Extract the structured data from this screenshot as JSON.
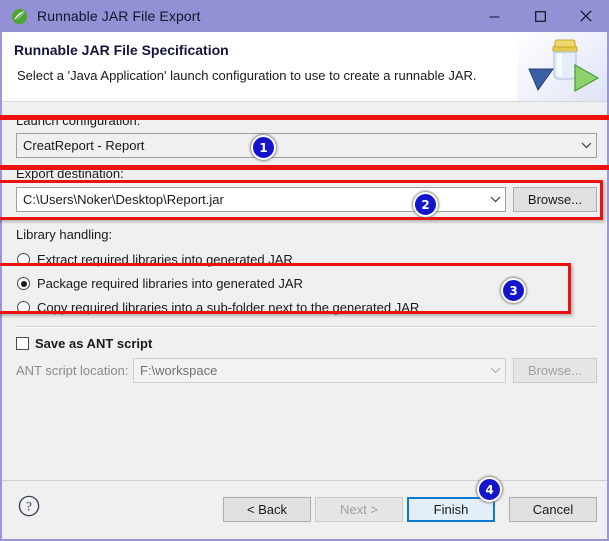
{
  "window": {
    "title": "Runnable JAR File Export",
    "icon": "eclipse-leaf-icon",
    "controls": {
      "minimize": "minimize-icon",
      "maximize": "maximize-icon",
      "close": "close-icon"
    },
    "titlebar_color": "#9490d6"
  },
  "header": {
    "title": "Runnable JAR File Specification",
    "description": "Select a 'Java Application' launch configuration to use to create a runnable JAR.",
    "icon": "jar-export-icon"
  },
  "launch_configuration": {
    "label": "Launch configuration:",
    "value": "CreatReport - Report",
    "chevron": "chevron-down-icon"
  },
  "export_destination": {
    "label": "Export destination:",
    "value": "C:\\Users\\Noker\\Desktop\\Report.jar",
    "chevron": "chevron-down-icon",
    "browse_label": "Browse..."
  },
  "library_handling": {
    "label": "Library handling:",
    "options": [
      {
        "label": "Extract required libraries into generated JAR",
        "selected": false
      },
      {
        "label": "Package required libraries into generated JAR",
        "selected": true
      },
      {
        "label": "Copy required libraries into a sub-folder next to the generated JAR",
        "selected": false
      }
    ]
  },
  "ant": {
    "checkbox_label": "Save as ANT script",
    "checked": false,
    "location_label": "ANT script location:",
    "location_value": "F:\\workspace",
    "browse_label": "Browse...",
    "chevron": "chevron-down-icon",
    "enabled": false
  },
  "footer": {
    "help": "help-icon",
    "back_label": "< Back",
    "next_label": "Next >",
    "next_disabled": true,
    "finish_label": "Finish",
    "finish_focused": true,
    "cancel_label": "Cancel"
  },
  "annotations": {
    "color": "#ee1111",
    "badge_color": "#1414cc",
    "badges": [
      {
        "number": "1",
        "target": "launch-configuration-combo"
      },
      {
        "number": "2",
        "target": "export-destination-combo"
      },
      {
        "number": "3",
        "target": "library-handling-options"
      },
      {
        "number": "4",
        "target": "finish-button"
      }
    ]
  }
}
